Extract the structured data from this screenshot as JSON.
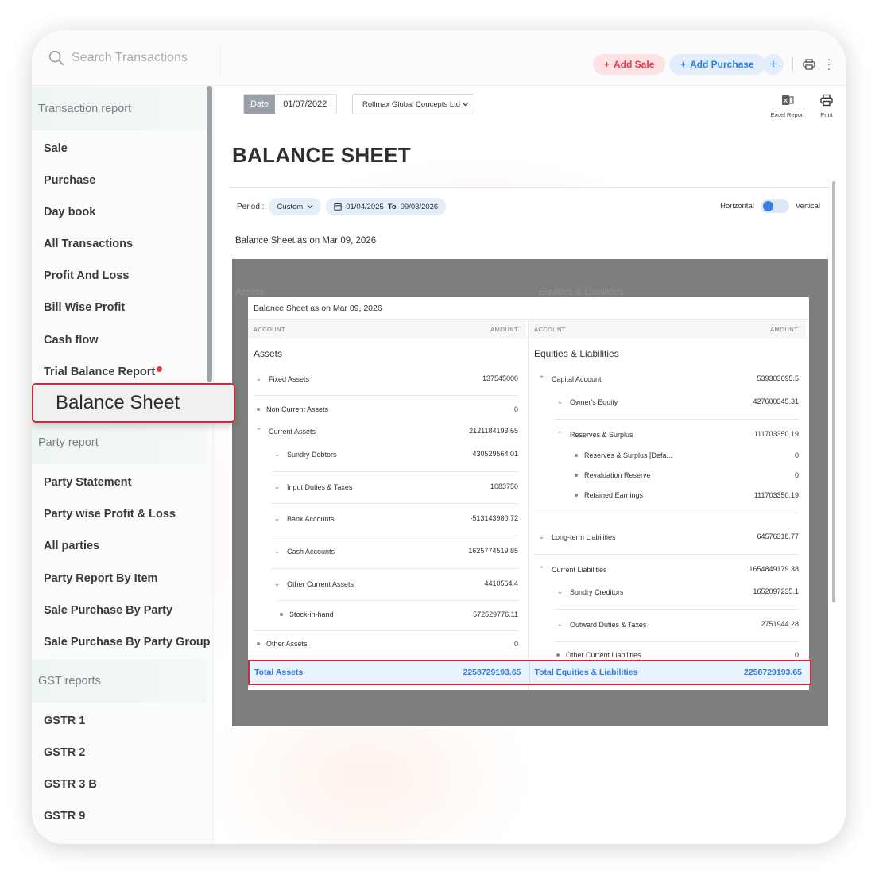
{
  "topbar": {
    "search_placeholder": "Search Transactions",
    "add_sale": "Add Sale",
    "add_purchase": "Add Purchase",
    "plus": "+"
  },
  "sidebar": {
    "sections": [
      {
        "title": "Transaction report"
      },
      {
        "title": "Party report"
      },
      {
        "title": "GST reports"
      }
    ],
    "transaction_items": [
      "Sale",
      "Purchase",
      "Day book",
      "All Transactions",
      "Profit And Loss",
      "Bill Wise Profit",
      "Cash flow",
      "Trial Balance Report"
    ],
    "active_item": "Balance Sheet",
    "party_items": [
      "Party Statement",
      "Party wise Profit & Loss",
      "All parties",
      "Party Report By Item",
      "Sale Purchase By Party",
      "Sale Purchase By Party Group"
    ],
    "gst_items": [
      "GSTR 1",
      "GSTR 2",
      "GSTR 3 B",
      "GSTR 9"
    ]
  },
  "toolbar": {
    "date_label": "Date",
    "date_value": "01/07/2022",
    "firm": "Rollmax Global Concepts Ltd",
    "excel_label": "Excel Report",
    "print_label": "Print"
  },
  "page_title": "BALANCE SHEET",
  "report": {
    "period_label": "Period :",
    "period_value": "Custom",
    "from_date": "01/04/2025",
    "to_label": "To",
    "to_date": "09/03/2026",
    "horizontal": "Horizontal",
    "vertical": "Vertical",
    "as_of": "Balance Sheet as on Mar 09, 2026"
  },
  "card": {
    "title": "Balance Sheet as on Mar 09, 2026",
    "col_account": "ACCOUNT",
    "col_amount": "AMOUNT",
    "assets": {
      "title": "Assets",
      "rows": [
        {
          "label": "Fixed Assets",
          "amount": "137545000"
        },
        {
          "label": "Non Current Assets",
          "amount": "0"
        },
        {
          "label": "Current Assets",
          "amount": "2121184193.65"
        },
        {
          "label": "Sundry Debtors",
          "amount": "430529564.01"
        },
        {
          "label": "Input Duties & Taxes",
          "amount": "1083750"
        },
        {
          "label": "Bank Accounts",
          "amount": "-513143980.72"
        },
        {
          "label": "Cash Accounts",
          "amount": "1625774519.85"
        },
        {
          "label": "Other Current Assets",
          "amount": "4410564.4"
        },
        {
          "label": "Stock-in-hand",
          "amount": "572529776.11"
        },
        {
          "label": "Other Assets",
          "amount": "0"
        }
      ]
    },
    "liabilities": {
      "title": "Equities & Liabilities",
      "rows": [
        {
          "label": "Capital Account",
          "amount": "539303695.5"
        },
        {
          "label": "Owner's Equity",
          "amount": "427600345.31"
        },
        {
          "label": "Reserves & Surplus",
          "amount": "111703350.19"
        },
        {
          "label": "Reserves & Surplus [Defa...",
          "amount": "0"
        },
        {
          "label": "Revaluation Reserve",
          "amount": "0"
        },
        {
          "label": "Retained Earnings",
          "amount": "111703350.19"
        },
        {
          "label": "Long-term Liabilities",
          "amount": "64576318.77"
        },
        {
          "label": "Current Liabilities",
          "amount": "1654849179.38"
        },
        {
          "label": "Sundry Creditors",
          "amount": "1652097235.1"
        },
        {
          "label": "Outward Duties & Taxes",
          "amount": "2751944.28"
        },
        {
          "label": "Other Current Liabilities",
          "amount": "0"
        }
      ]
    }
  },
  "totals": {
    "assets_label": "Total Assets",
    "assets_value": "2258729193.65",
    "liabilities_label": "Total Equities & Liabilities",
    "liabilities_value": "2258729193.65"
  },
  "colors": {
    "accent": "#2f7ce0",
    "danger": "#e3374a",
    "highlight": "#cc2b3c"
  }
}
